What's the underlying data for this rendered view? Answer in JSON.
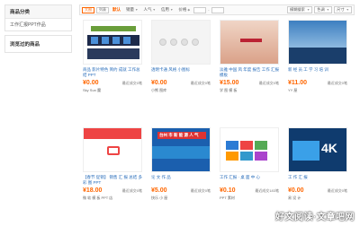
{
  "sidebar": {
    "category_title": "商品分类",
    "category_item": "工作汇报PPT作品",
    "viewed_title": "浏览过的商品"
  },
  "toolbar": {
    "view_grid": "大图",
    "view_list": "列表",
    "sort": [
      "默认",
      "销量",
      "人气",
      "信用",
      "价格"
    ],
    "sort_default": "默认",
    "dash": "-",
    "select_all": "模糊搜索",
    "select_color": "色调",
    "select_size": "尺寸"
  },
  "products": [
    {
      "title": "商品 影片特色 简约 成就 工作总结 PPT",
      "price": "¥0.00",
      "sales": "最近成交0笔",
      "shop": "Sky Sun 魔"
    },
    {
      "title": "透明卡通 风格 小图标",
      "price": "¥0.00",
      "sales": "最近成交0笔",
      "shop": "小熊 图库"
    },
    {
      "title": "淡雅 中国 风 年度 报告 工作 汇报 模板",
      "price": "¥15.00",
      "sales": "最近成交0笔",
      "shop": "学 图 模 板"
    },
    {
      "title": "新 经 员 工 学 习 培 训",
      "price": "¥11.00",
      "sales": "最近成交0笔",
      "shop": "YY 屋"
    },
    {
      "title": "【春节 促销】 销售 汇 报 总结 多彩 图 PPT",
      "price": "¥18.00",
      "sales": "最近成交0笔",
      "shop": "微 软 模 板 PPT 店"
    },
    {
      "title": "论 文 作 品",
      "price": "¥5.00",
      "sales": "最近成交0笔",
      "shop": "快乐 小 屋"
    },
    {
      "title": "工作 汇报 · 桌 面 中 心",
      "price": "¥0.10",
      "sales": "最近成交183笔",
      "shop": "PPT 素材"
    },
    {
      "title": "工 作 汇 报",
      "price": "¥0.00",
      "sales": "最近成交0笔",
      "shop": "易 设 计"
    }
  ],
  "thumb_texts": {
    "t6": "台州 市 新 能 源 人 气",
    "t8": "4K"
  },
  "watermark": "好文阅读·文章吧网"
}
